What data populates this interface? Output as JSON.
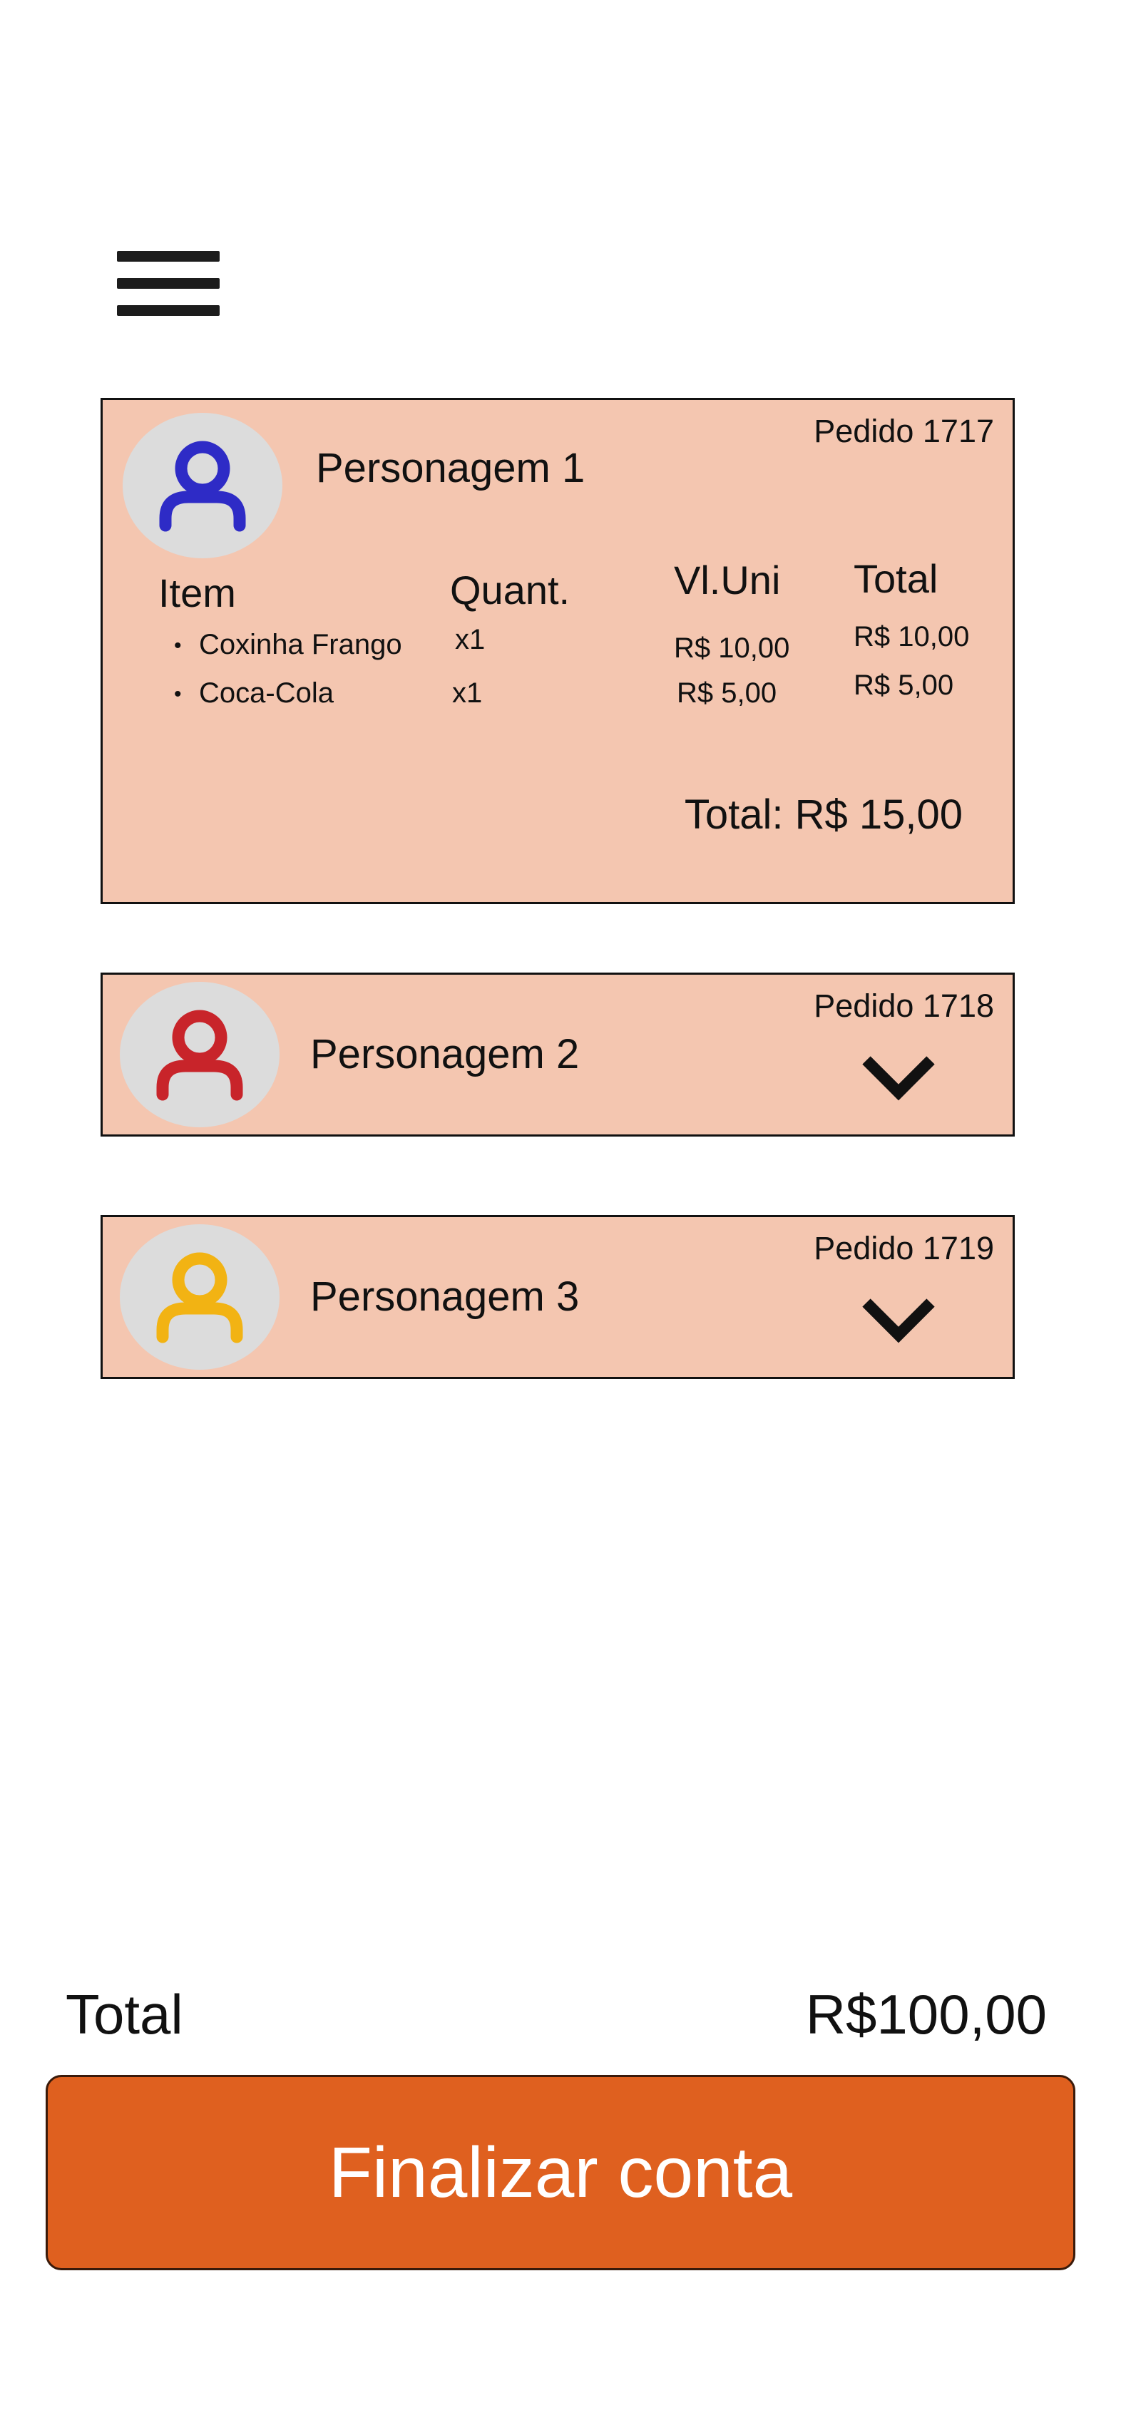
{
  "toolbar": {
    "menu_icon": "hamburger-menu-icon"
  },
  "orders": [
    {
      "order_label": "Pedido 1717",
      "character": "Personagem 1",
      "avatar_color": "#2e2bc6",
      "expanded": true,
      "table": {
        "headers": {
          "item": "Item",
          "qty": "Quant.",
          "unit": "Vl.Uni",
          "total": "Total"
        },
        "rows": [
          {
            "item": "Coxinha Frango",
            "qty": "x1",
            "unit": "R$ 10,00",
            "total": "R$ 10,00"
          },
          {
            "item": "Coca-Cola",
            "qty": "x1",
            "unit": "R$ 5,00",
            "total": "R$ 5,00"
          }
        ]
      },
      "order_total": "Total: R$ 15,00"
    },
    {
      "order_label": "Pedido 1718",
      "character": "Personagem 2",
      "avatar_color": "#c8242a",
      "expanded": false
    },
    {
      "order_label": "Pedido 1719",
      "character": "Personagem 3",
      "avatar_color": "#f2b313",
      "expanded": false
    }
  ],
  "summary": {
    "label": "Total",
    "value": "R$100,00"
  },
  "finish_button": {
    "label": "Finalizar conta",
    "color": "#df601f"
  },
  "colors": {
    "card_background": "#f4c6b0",
    "avatar_background": "#dcdcdc"
  }
}
